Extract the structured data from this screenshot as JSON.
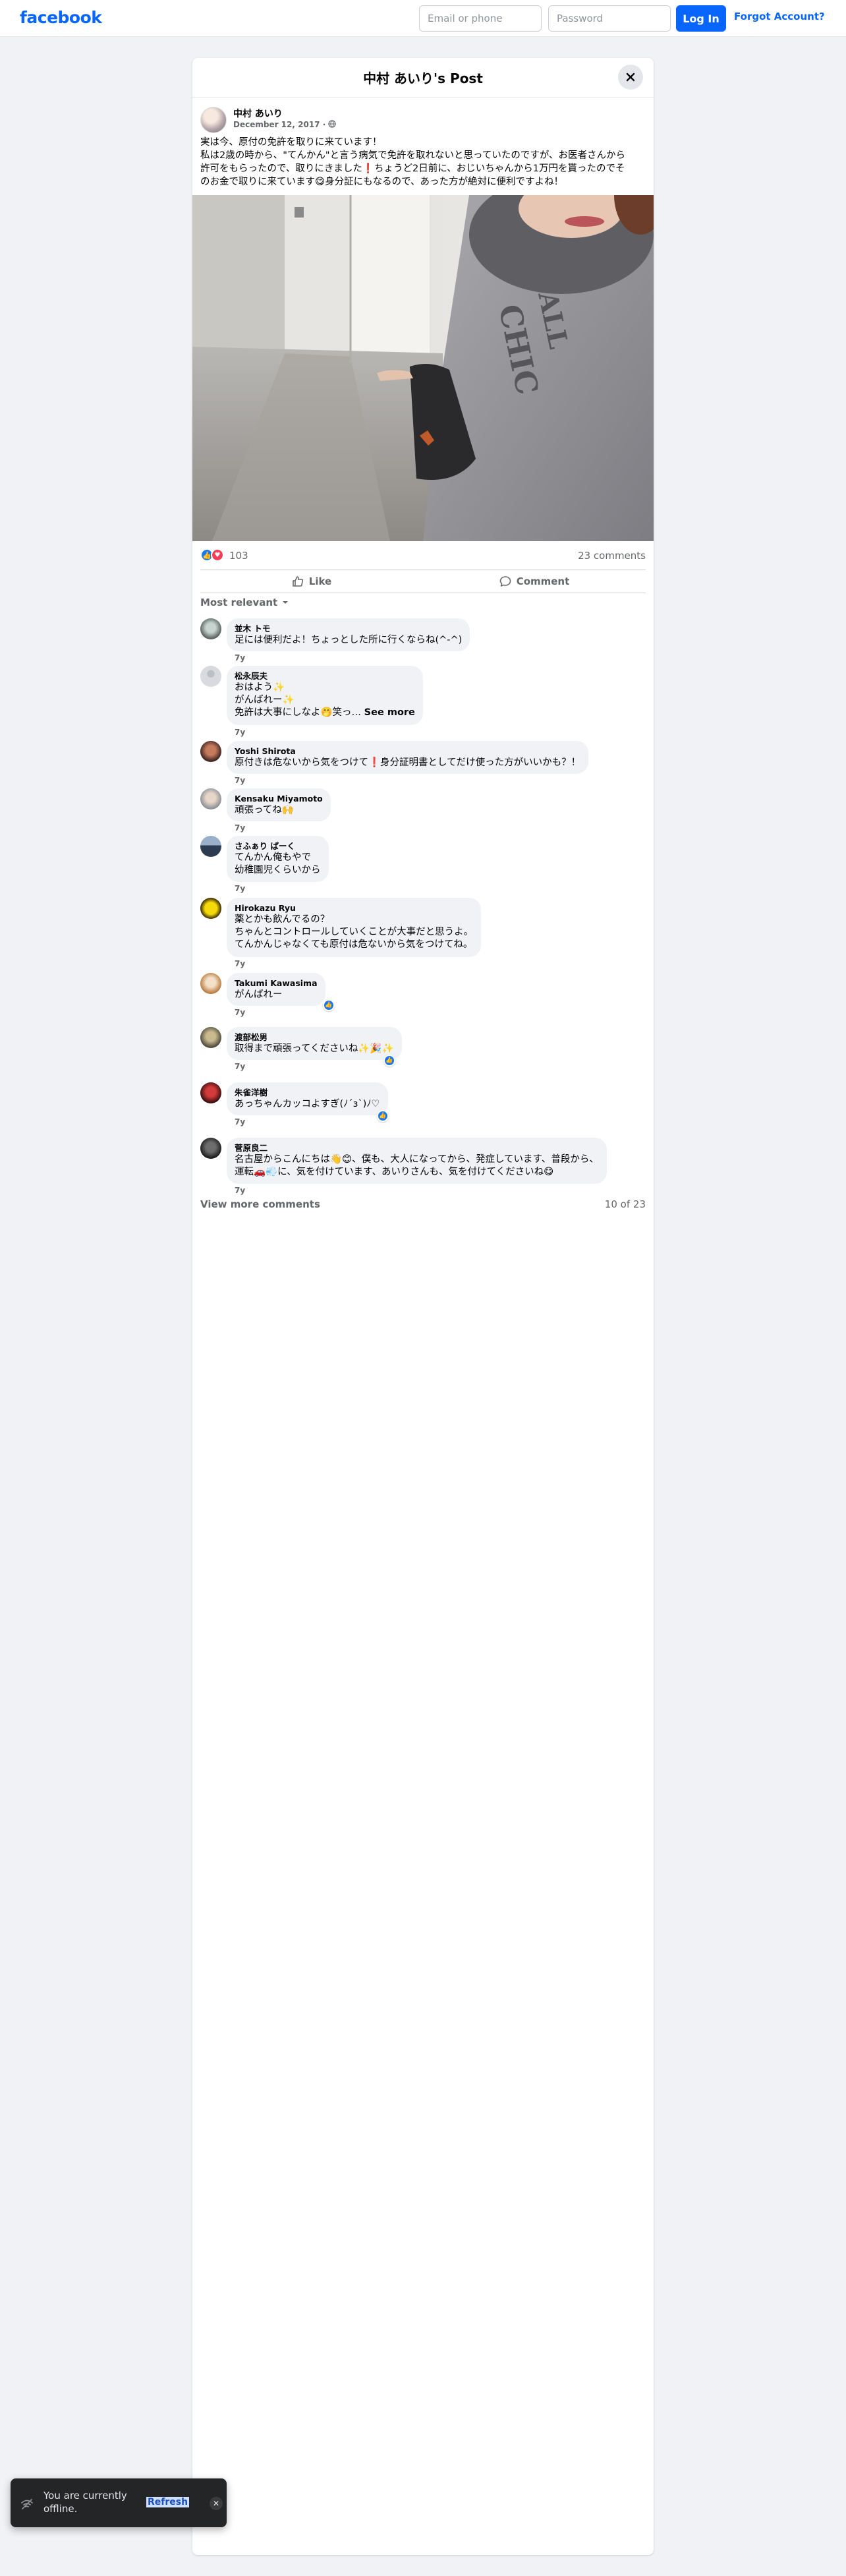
{
  "header": {
    "logo": "facebook",
    "email_placeholder": "Email or phone",
    "password_placeholder": "Password",
    "login_label": "Log In",
    "forgot_label": "Forgot Account?"
  },
  "post_dialog": {
    "title": "中村 あいり's Post",
    "author": "中村 あいり",
    "date": "December 12, 2017 · ",
    "text_lines": [
      "実は今、原付の免許を取りに来ています！",
      "私は2歳の時から、\"てんかん\"と言う病気で免許を取れないと思っていたのですが、お医者さんから",
      "許可をもらったので、取りにきました❗ちょうど2日前に、おじいちゃんから1万円を貰ったのでそ",
      "のお金で取りに来ています😋身分証にもなるので、あった方が絶対に便利ですよね！"
    ],
    "reaction_count": "103",
    "comment_count": "23 comments",
    "like_label": "Like",
    "comment_label": "Comment",
    "sort_label": "Most relevant"
  },
  "comments": [
    {
      "name": "並木 トモ",
      "lines": [
        "足には便利だよ！ちょっとした所に行くならね(^-^)"
      ],
      "time": "7y"
    },
    {
      "name": "松永辰夫",
      "lines": [
        "おはよう✨",
        "がんばれー✨",
        "免許は大事にしなよ🤭笑っ… "
      ],
      "see_more": "See more",
      "time": "7y"
    },
    {
      "name": "Yoshi Shirota",
      "lines": [
        "原付きは危ないから気をつけて❗身分証明書としてだけ使った方がいいかも？！"
      ],
      "time": "7y"
    },
    {
      "name": "Kensaku Miyamoto",
      "lines": [
        "頑張ってね🙌"
      ],
      "time": "7y"
    },
    {
      "name": "さふぁり ぱーく",
      "lines": [
        "てんかん俺もやで",
        "幼稚園児くらいから"
      ],
      "time": "7y"
    },
    {
      "name": "Hirokazu Ryu",
      "lines": [
        "薬とかも飲んでるの？",
        "ちゃんとコントロールしていくことが大事だと思うよ。",
        "てんかんじゃなくても原付は危ないから気をつけてね。"
      ],
      "time": "7y"
    },
    {
      "name": "Takumi Kawasima",
      "lines": [
        "がんばれー"
      ],
      "time": "7y"
    },
    {
      "name": "渡部松男",
      "lines": [
        "取得まで頑張ってくださいね✨🎉✨"
      ],
      "time": "7y"
    },
    {
      "name": "朱雀洋樹",
      "lines": [
        "あっちゃんカッコよすぎ(ﾉ´з`)ﾉ♡"
      ],
      "time": "7y"
    },
    {
      "name": "菅原良二",
      "lines": [
        "名古屋からこんにちは👋😊、僕も、大人になってから、発症しています、普段から、",
        "運転🚗💨に、気を付けています、あいりさんも、気を付けてくださいね😋"
      ],
      "time": "7y"
    }
  ],
  "more": {
    "label": "View more comments",
    "count": "10 of 23"
  },
  "toast": {
    "text": "You are currently offline.",
    "link": "Refresh"
  },
  "colors": {
    "brand": "#0866ff",
    "background": "#f0f2f5"
  }
}
